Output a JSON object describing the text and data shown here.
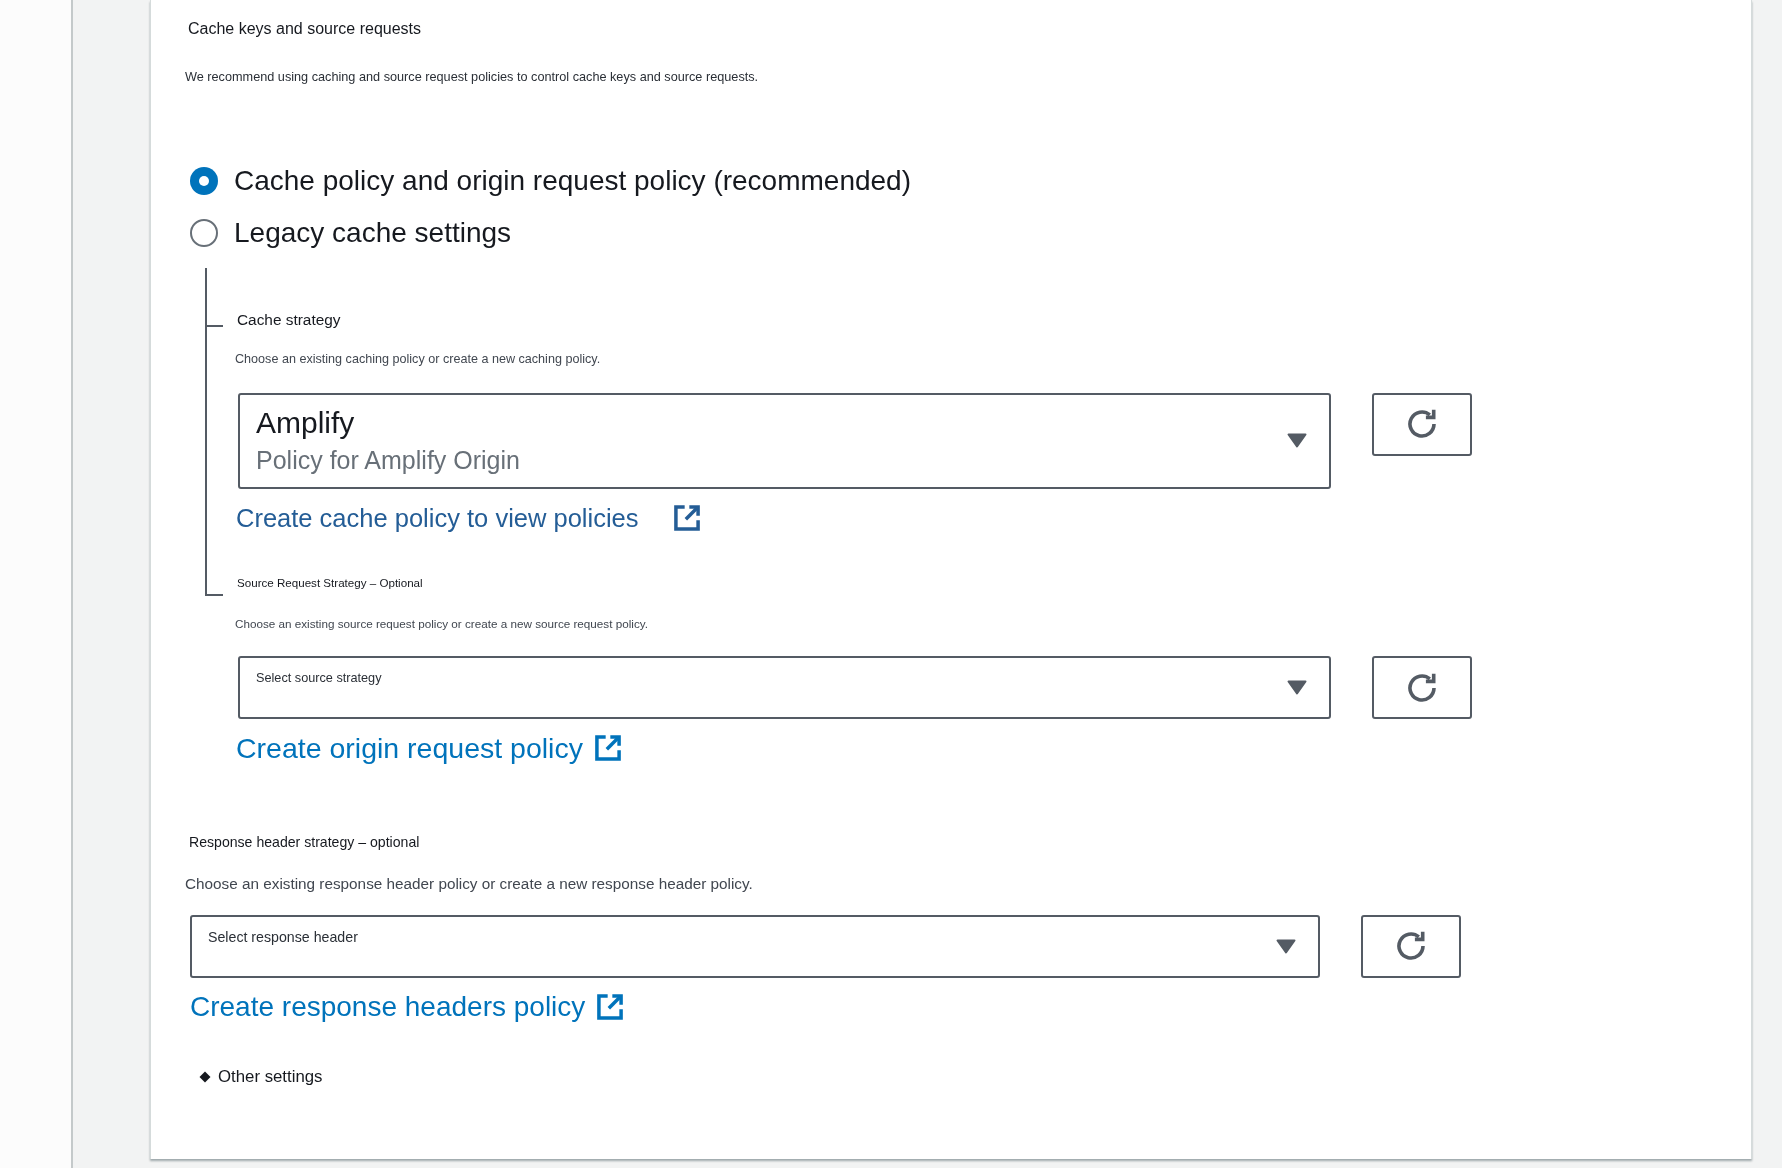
{
  "section": {
    "title": "Cache keys and source requests",
    "description": "We recommend using caching and source request policies to control cache keys and source requests."
  },
  "cache_options": [
    {
      "label": "Cache policy and origin request policy (recommended)",
      "selected": true
    },
    {
      "label": "Legacy cache settings",
      "selected": false
    }
  ],
  "strategies": [
    {
      "kind": "nested",
      "title": "Cache strategy",
      "description": "Choose an existing caching policy or create a new caching policy.",
      "select": {
        "value": "Amplify",
        "detail": "Policy for Amplify Origin"
      },
      "link": {
        "label": "Create cache policy to view policies",
        "visited": true
      }
    },
    {
      "kind": "nested",
      "title": "Source Request Strategy – Optional",
      "description": "Choose an existing source request policy or create a new source request policy.",
      "select": {
        "placeholder": "Select source strategy"
      },
      "link": {
        "label": "Create origin request policy",
        "visited": false
      }
    },
    {
      "kind": "top",
      "title": "Response header strategy – optional",
      "description": "Choose an existing response header policy or create a new response header policy.",
      "select": {
        "placeholder": "Select response header"
      },
      "link": {
        "label": "Create response headers policy",
        "visited": false
      }
    }
  ],
  "other_settings": {
    "label": "Other settings"
  }
}
